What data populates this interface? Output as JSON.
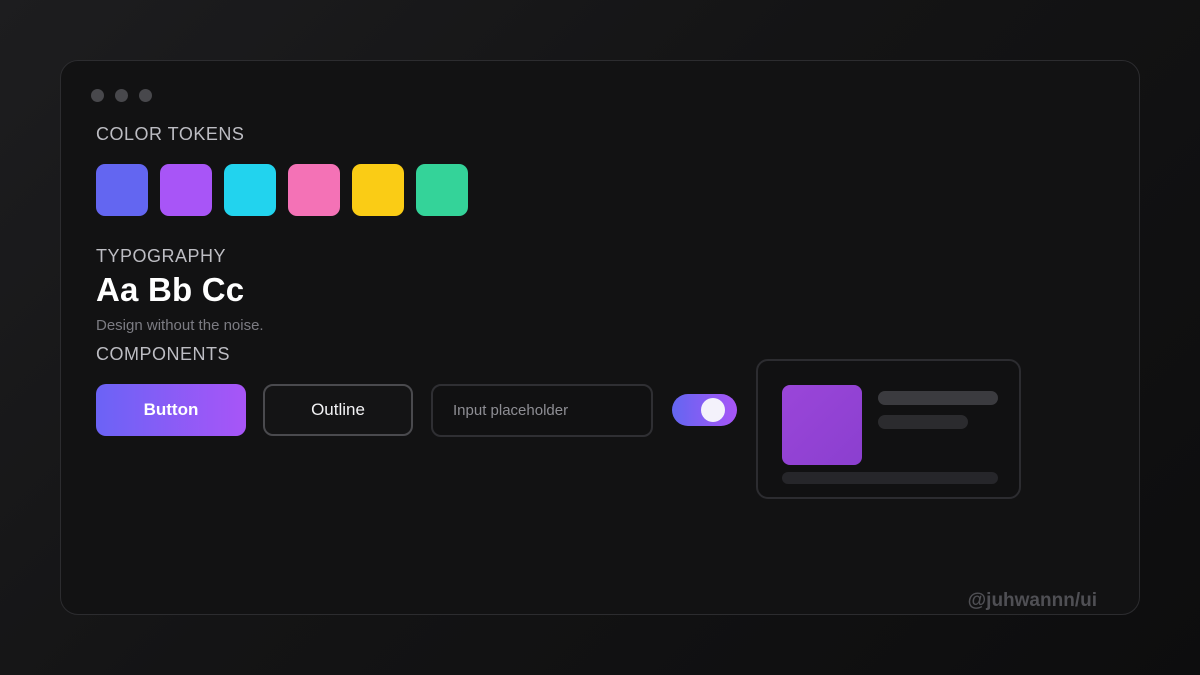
{
  "sections": {
    "color_tokens_label": "COLOR TOKENS",
    "typography_label": "TYPOGRAPHY",
    "components_label": "COMPONENTS"
  },
  "color_tokens": [
    "#6366f1",
    "#a855f7",
    "#22d3ee",
    "#f472b6",
    "#facc15",
    "#34d399"
  ],
  "typography": {
    "sample": "Aa Bb Cc",
    "caption": "Design without the noise."
  },
  "components": {
    "primary_button_label": "Button",
    "outline_button_label": "Outline",
    "input_placeholder": "Input placeholder",
    "toggle_on": true
  },
  "watermark": "@juhwannn/ui"
}
